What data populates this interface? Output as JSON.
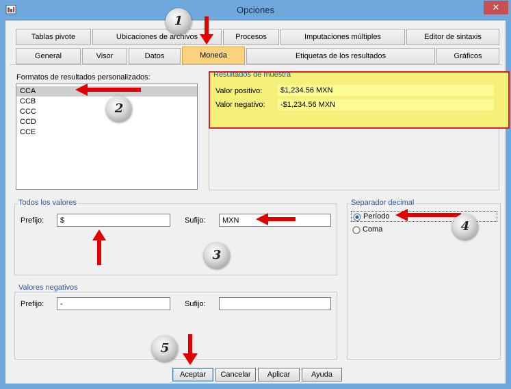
{
  "window": {
    "title": "Opciones",
    "close_label": "✕"
  },
  "tabs_row1": [
    "Tablas pivote",
    "Ubicaciones de archivos",
    "Procesos",
    "Imputaciones múltiples",
    "Editor de sintaxis"
  ],
  "tabs_row2": [
    "General",
    "Visor",
    "Datos",
    "Moneda",
    "Etiquetas de los resultados",
    "Gráficos"
  ],
  "formats": {
    "label": "Formatos de resultados personalizados:",
    "items": [
      "CCA",
      "CCB",
      "CCC",
      "CCD",
      "CCE"
    ],
    "selected": "CCA"
  },
  "sample": {
    "legend": "Resultados de muestra",
    "positive_label": "Valor positivo:",
    "positive_value": "$1,234.56 MXN",
    "negative_label": "Valor negativo:",
    "negative_value": "-$1,234.56 MXN"
  },
  "all_values": {
    "legend": "Todos los valores",
    "prefix_label": "Prefijo:",
    "prefix_value": "$",
    "suffix_label": "Sufijo:",
    "suffix_value": "MXN"
  },
  "negative_values": {
    "legend": "Valores negativos",
    "prefix_label": "Prefijo:",
    "prefix_value": "-",
    "suffix_label": "Sufijo:",
    "suffix_value": ""
  },
  "decimal_separator": {
    "legend": "Separador decimal",
    "options": [
      "Período",
      "Coma"
    ],
    "selected": "Período"
  },
  "buttons": {
    "ok": "Aceptar",
    "cancel": "Cancelar",
    "apply": "Aplicar",
    "help": "Ayuda"
  },
  "badges": [
    "1",
    "2",
    "3",
    "4",
    "5"
  ],
  "colors": {
    "active_tab": "#fbd37e",
    "sample_highlight": "#f4f07a",
    "annotation_red": "#e00000",
    "title_bar": "#6fa8dc"
  }
}
